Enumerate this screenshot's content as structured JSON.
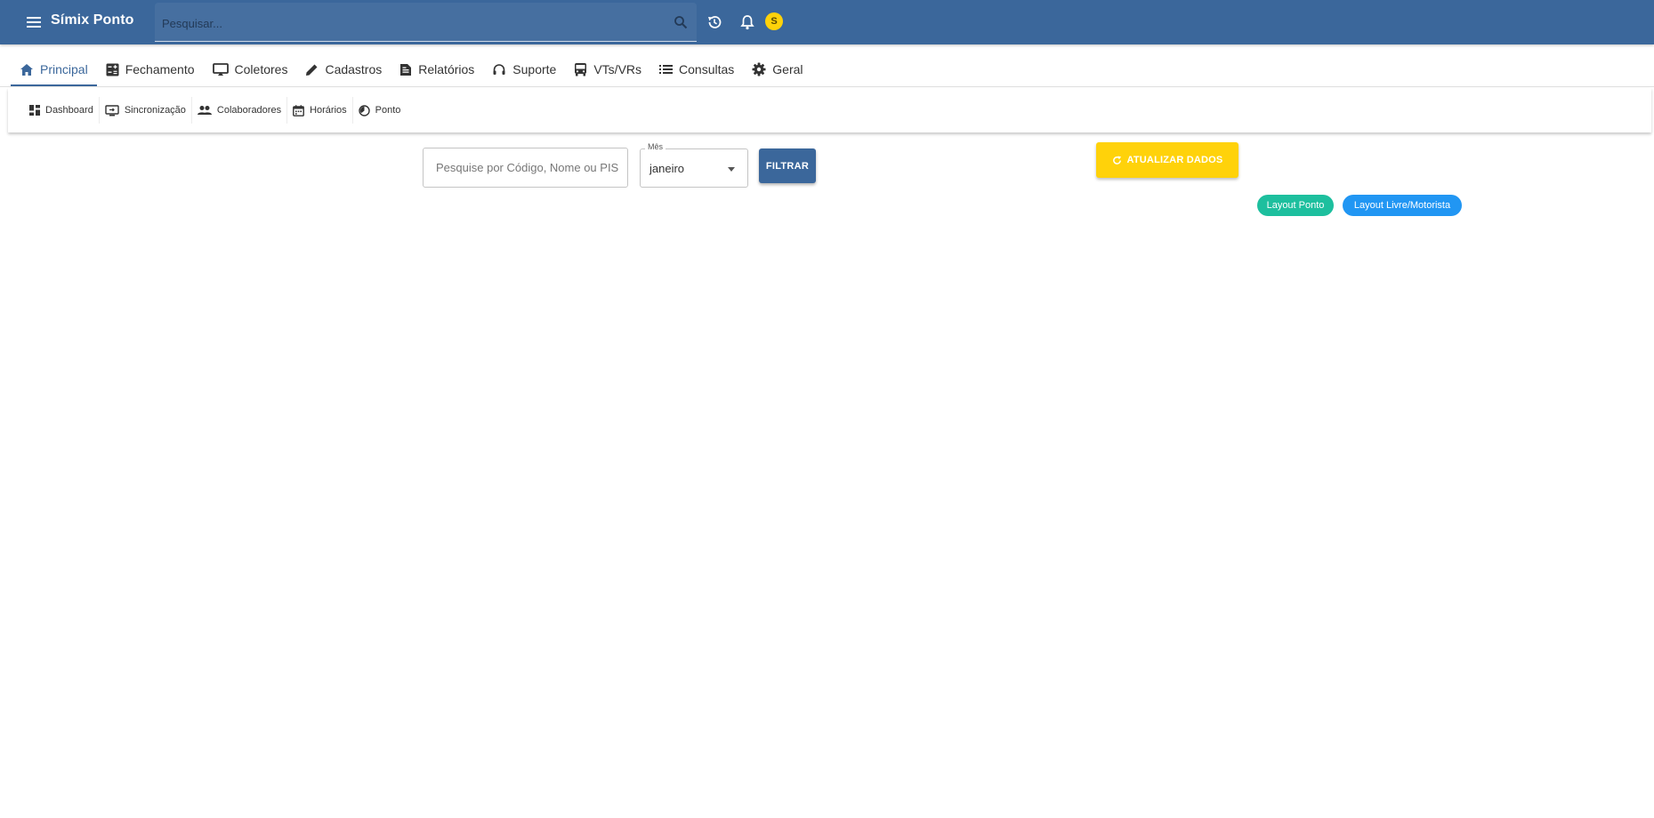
{
  "header": {
    "title": "Símix Ponto",
    "search_placeholder": "Pesquisar...",
    "avatar_initial": "S",
    "icons": [
      "menu-icon",
      "search-icon",
      "history-icon",
      "bell-icon"
    ]
  },
  "tabs": [
    {
      "label": "Principal",
      "icon": "home-icon",
      "active": true
    },
    {
      "label": "Fechamento",
      "icon": "calculator-icon",
      "active": false
    },
    {
      "label": "Coletores",
      "icon": "monitor-icon",
      "active": false
    },
    {
      "label": "Cadastros",
      "icon": "pencil-icon",
      "active": false
    },
    {
      "label": "Relatórios",
      "icon": "report-icon",
      "active": false
    },
    {
      "label": "Suporte",
      "icon": "headset-icon",
      "active": false
    },
    {
      "label": "VTs/VRs",
      "icon": "bus-icon",
      "active": false
    },
    {
      "label": "Consultas",
      "icon": "list-icon",
      "active": false
    },
    {
      "label": "Geral",
      "icon": "gear-icon",
      "active": false
    }
  ],
  "subnav": [
    {
      "label": "Dashboard",
      "icon": "dashboard-icon"
    },
    {
      "label": "Sincronização",
      "icon": "sync-screen-icon"
    },
    {
      "label": "Colaboradores",
      "icon": "people-icon"
    },
    {
      "label": "Horários",
      "icon": "calendar-icon"
    },
    {
      "label": "Ponto",
      "icon": "clock-icon"
    }
  ],
  "filter": {
    "search_placeholder": "Pesquise por Código, Nome ou PIS",
    "month_label": "Mês",
    "month_value": "janeiro",
    "filter_button": "FILTRAR"
  },
  "actions": {
    "update_button": "ATUALIZAR DADOS",
    "layout_ponto": "Layout Ponto",
    "layout_livre": "Layout Livre/Motorista"
  },
  "colors": {
    "primary": "#3b679b",
    "warning": "#ffd20a",
    "teal": "#1dbf9e",
    "blue": "#2196f3"
  }
}
